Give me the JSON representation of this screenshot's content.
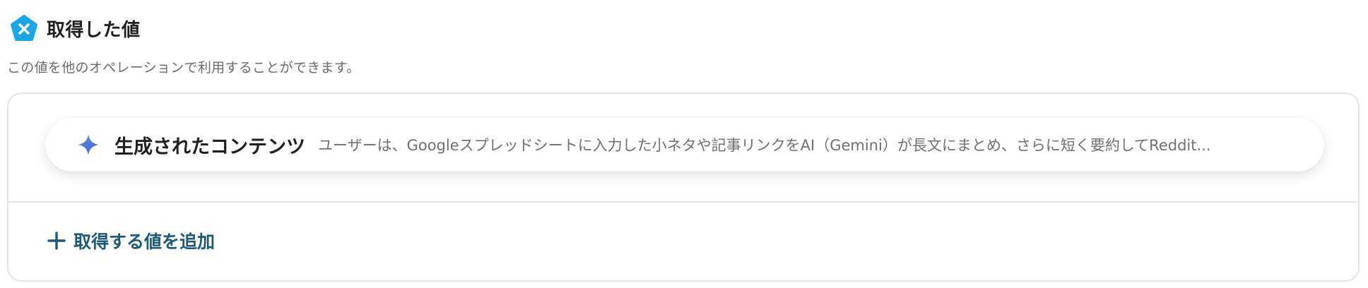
{
  "header": {
    "title": "取得した値",
    "logo_icon": "hexagon-x-logo-icon"
  },
  "subtitle": "この値を他のオペレーションで利用することができます。",
  "values": [
    {
      "name": "生成されたコンテンツ",
      "preview": "ユーザーは、Googleスプレッドシートに入力した小ネタや記事リンクをAI（Gemini）が長文にまとめ、さらに短く要約してReddit...",
      "icon": "sparkle-icon"
    }
  ],
  "add_button": {
    "label": "取得する値を追加",
    "icon": "plus-icon"
  },
  "colors": {
    "logo_fill": "#1aa7e8",
    "sparkle_fill": "#4b78d8",
    "add_text": "#1d5b75",
    "border": "#e3e3e8",
    "muted_text": "#707070"
  }
}
